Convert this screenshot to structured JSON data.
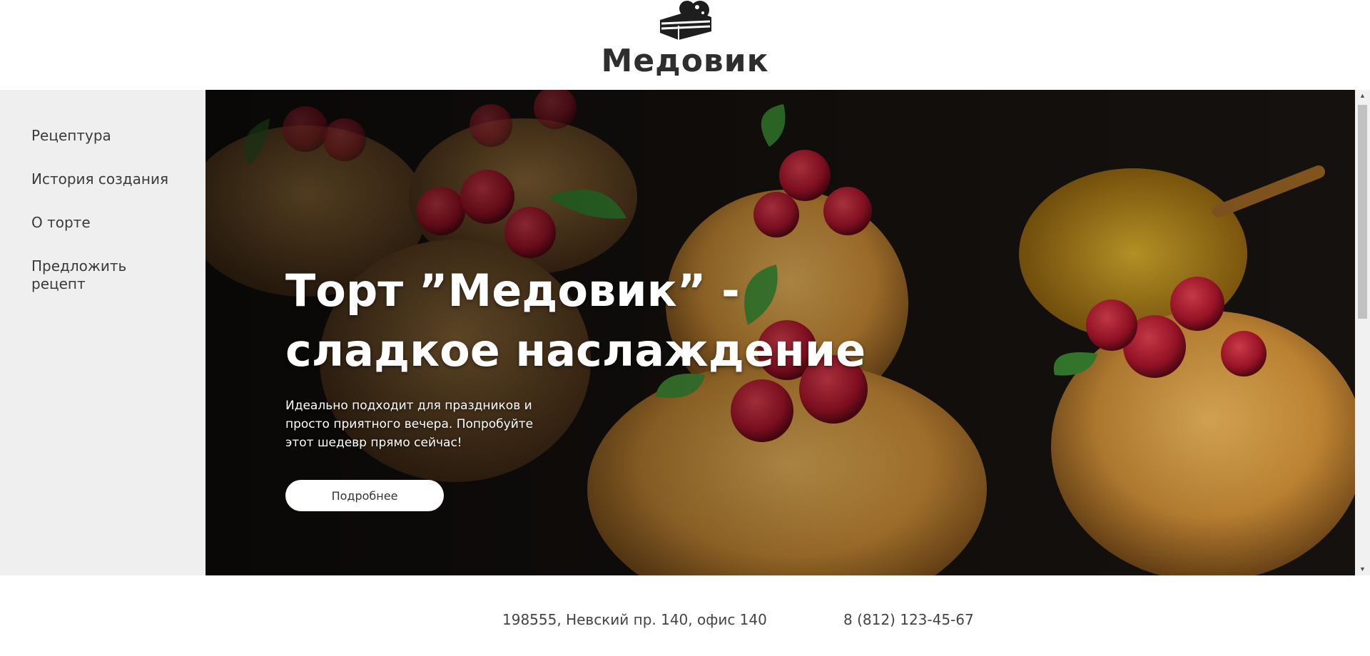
{
  "header": {
    "logo_icon": "cake-slice-icon",
    "title": "Медовик"
  },
  "sidebar": {
    "items": [
      {
        "label": "Рецептура"
      },
      {
        "label": "История создания"
      },
      {
        "label": "О торте"
      },
      {
        "label": "Предложить рецепт"
      }
    ]
  },
  "hero": {
    "title_line1": "Торт ”Медовик” -",
    "title_line2": "сладкое наслаждение",
    "description": "Идеально подходит для праздников и просто приятного вечера. Попробуйте этот шедевр прямо сейчас!",
    "button_label": "Подробнее",
    "background_image": "honey-cakes-with-raspberries-photo"
  },
  "footer": {
    "address": "198555, Невский пр. 140, офис 140",
    "phone": "8 (812) 123-45-67"
  },
  "colors": {
    "sidebar_bg": "#efefef",
    "hero_text": "#ffffff",
    "button_bg": "#ffffff",
    "text": "#333333"
  }
}
